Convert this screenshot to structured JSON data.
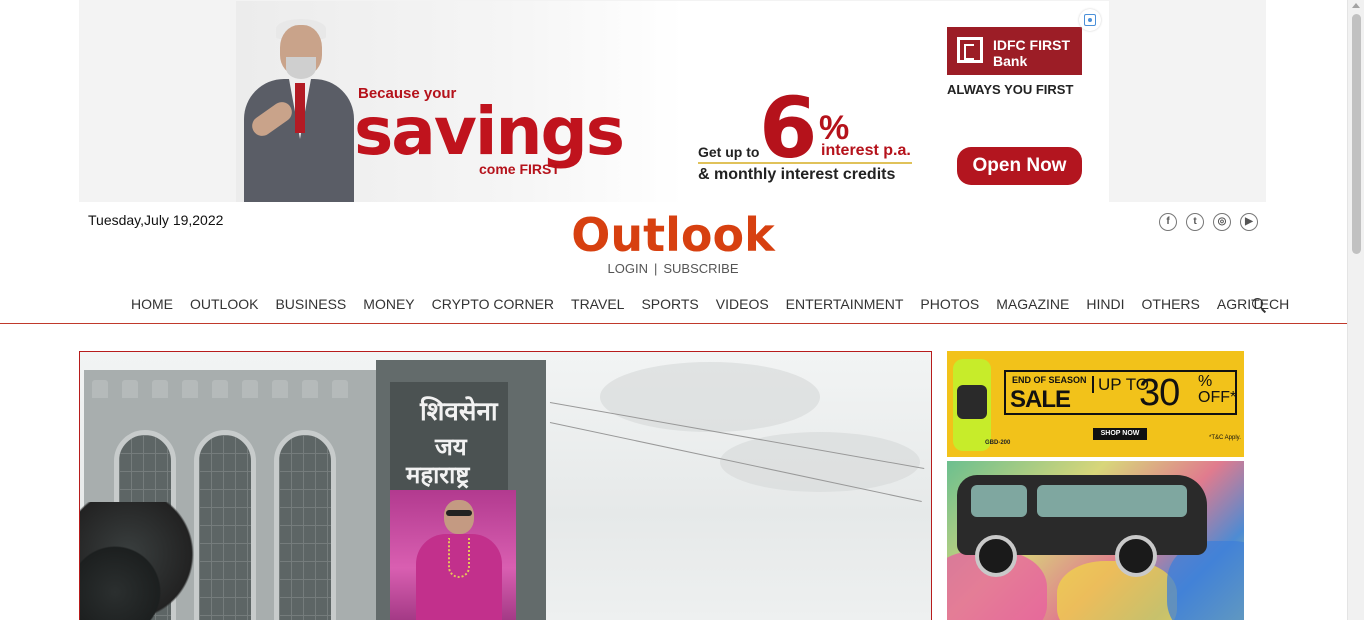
{
  "top_ad": {
    "tagline_top": "Because your",
    "headline": "savings",
    "tagline_bottom": "come FIRST",
    "offer_prefix": "Get up to",
    "offer_rate": "6",
    "offer_percent": "%",
    "offer_suffix": "interest p.a.",
    "offer_detail": "& monthly interest credits",
    "bank_name": "IDFC FIRST Bank",
    "bank_slogan": "ALWAYS YOU FIRST",
    "cta": "Open Now"
  },
  "header": {
    "date": "Tuesday,July 19,2022",
    "logo": "Outlook",
    "login": "LOGIN",
    "separator": "|",
    "subscribe": "SUBSCRIBE",
    "social": [
      {
        "name": "facebook-icon",
        "glyph": "f"
      },
      {
        "name": "twitter-icon",
        "glyph": "t"
      },
      {
        "name": "instagram-icon",
        "glyph": "◎"
      },
      {
        "name": "youtube-icon",
        "glyph": "▶"
      }
    ]
  },
  "nav": {
    "items": [
      "HOME",
      "OUTLOOK",
      "BUSINESS",
      "MONEY",
      "CRYPTO CORNER",
      "TRAVEL",
      "SPORTS",
      "VIDEOS",
      "ENTERTAINMENT",
      "PHOTOS",
      "MAGAZINE",
      "HINDI",
      "OTHERS",
      "AGRITECH"
    ]
  },
  "hero": {
    "sign_line1": "शिवसेना",
    "sign_line2": "जय",
    "sign_line3": "महाराष्ट्र"
  },
  "side_ad": {
    "model": "GBD-200",
    "season": "END OF SEASON",
    "sale": "SALE",
    "upto": "UP TO",
    "discount": "30",
    "off": "% OFF*",
    "cta": "SHOP NOW",
    "terms": "*T&C Apply."
  },
  "colors": {
    "brand": "#d74010",
    "nav_line": "#c0392b",
    "ad_red": "#b5121b",
    "side_ad_yellow": "#f2c21a"
  }
}
